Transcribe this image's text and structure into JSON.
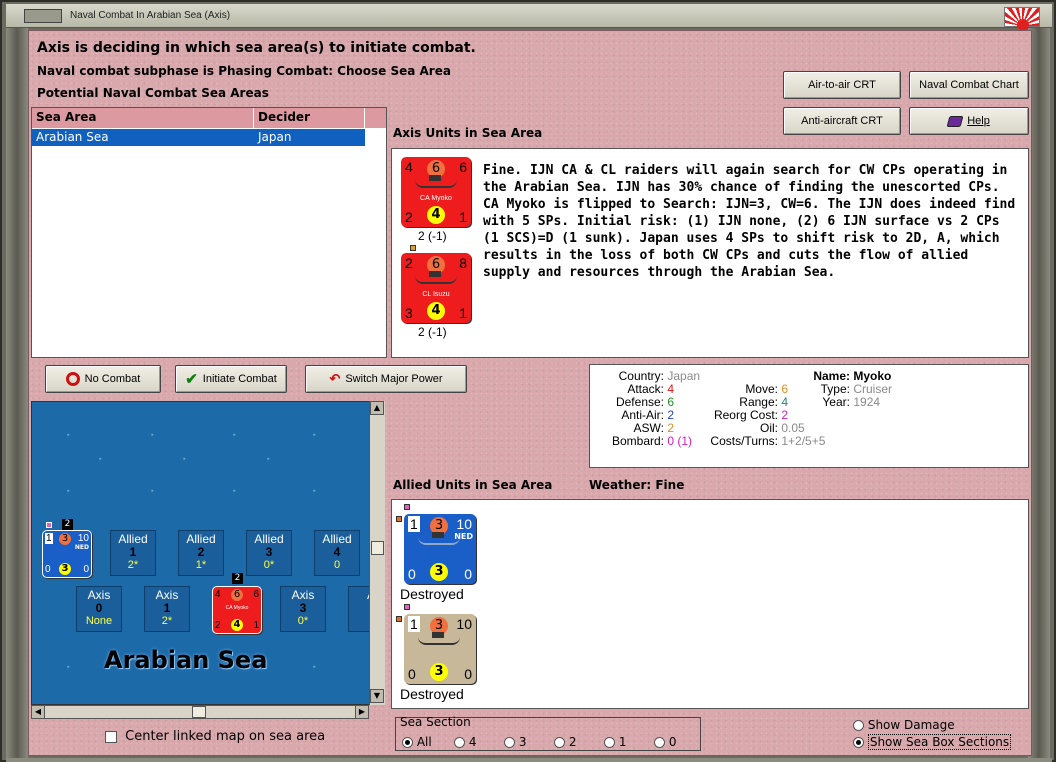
{
  "window": {
    "title": "Naval Combat In Arabian Sea (Axis)"
  },
  "headers": {
    "line1": "Axis is deciding in which sea area(s) to initiate combat.",
    "line2": "Naval combat subphase is Phasing Combat: Choose Sea Area",
    "line3": "Potential Naval Combat Sea Areas"
  },
  "buttons": {
    "air_to_air": "Air-to-air CRT",
    "naval_chart": "Naval Combat Chart",
    "anti_aircraft": "Anti-aircraft CRT",
    "help": "Help",
    "no_combat": "No Combat",
    "initiate_combat": "Initiate Combat",
    "switch_major_power": "Switch Major Power"
  },
  "sea_table": {
    "columns": [
      "Sea Area",
      "Decider"
    ],
    "rows": [
      [
        "Arabian Sea",
        "Japan"
      ]
    ]
  },
  "axis_units": {
    "heading": "Axis Units in Sea Area",
    "narrative": "Fine.  IJN CA & CL raiders will again search for CW CPs operating in the Arabian Sea.  IJN has 30% chance of finding the unescorted CPs.  CA Myoko is flipped to Search:  IJN=3, CW=6.  The IJN does indeed find with 5 SPs.  Initial risk:  (1) IJN none, (2) 6 IJN surface vs 2 CPs (1 SCS)=D (1 sunk).  Japan uses 4 SPs to shift risk to 2D, A, which results in the loss of both CW CPs and cuts the flow of allied supply and resources through the Arabian Sea.",
    "counters": [
      {
        "tl": "4",
        "tc": "6",
        "tr": "6",
        "name": "CA Myoko",
        "bl": "2",
        "bc": "4",
        "br": "1",
        "below": "2 (-1)"
      },
      {
        "tl": "2",
        "tc": "6",
        "tr": "8",
        "name": "CL Isuzu",
        "bl": "3",
        "bc": "4",
        "br": "1",
        "below": "2 (-1)"
      }
    ]
  },
  "details": {
    "country_label": "Country:",
    "country": "Japan",
    "attack_label": "Attack:",
    "attack": "4",
    "defense_label": "Defense:",
    "defense": "6",
    "antiair_label": "Anti-Air:",
    "antiair": "2",
    "asw_label": "ASW:",
    "asw": "2",
    "bombard_label": "Bombard:",
    "bombard": "0 (1)",
    "move_label": "Move:",
    "move": "6",
    "range_label": "Range:",
    "range": "4",
    "reorg_label": "Reorg Cost:",
    "reorg": "2",
    "oil_label": "Oil:",
    "oil": "0.05",
    "costs_label": "Costs/Turns:",
    "costs": "1+2/5+5",
    "name_label": "Name:",
    "name": "Myoko",
    "type_label": "Type:",
    "type": "Cruiser",
    "year_label": "Year:",
    "year": "1924"
  },
  "map": {
    "sea_name": "Arabian Sea",
    "allied_boxes": [
      {
        "label": "Allied",
        "num": "1",
        "val": "2*"
      },
      {
        "label": "Allied",
        "num": "2",
        "val": "1*"
      },
      {
        "label": "Allied",
        "num": "3",
        "val": "0*"
      },
      {
        "label": "Allied",
        "num": "4",
        "val": "0"
      }
    ],
    "axis_boxes": [
      {
        "label": "Axis",
        "num": "0",
        "val": "None"
      },
      {
        "label": "Axis",
        "num": "1",
        "val": "2*"
      },
      {
        "label": "Axis",
        "num": "3",
        "val": "0*"
      },
      {
        "label": "A",
        "num": "",
        "val": ""
      }
    ],
    "allied_stack_count": "2",
    "axis_stack_count": "2",
    "allied_counter": {
      "tl": "1",
      "tc": "3",
      "tr": "10",
      "tag": "NED",
      "bl": "0",
      "bc": "3",
      "br": "0"
    },
    "axis_counter": {
      "tl": "4",
      "tc": "6",
      "tr": "6",
      "name": "CA Myoko",
      "bl": "2",
      "bc": "4",
      "br": "1"
    }
  },
  "allied_units": {
    "heading": "Allied Units in Sea Area",
    "weather": "Weather:  Fine",
    "counters": [
      {
        "tl": "1",
        "tc": "3",
        "tr": "10",
        "tag": "NED",
        "bl": "0",
        "bc": "3",
        "br": "0",
        "status": "Destroyed"
      },
      {
        "tl": "1",
        "tc": "3",
        "tr": "10",
        "tag": "",
        "bl": "0",
        "bc": "3",
        "br": "0",
        "status": "Destroyed"
      }
    ]
  },
  "options": {
    "center_map": "Center linked map on sea area",
    "sea_section_label": "Sea Section",
    "sections": [
      "All",
      "4",
      "3",
      "2",
      "1",
      "0"
    ],
    "show_damage": "Show Damage",
    "show_sea_box": "Show Sea Box Sections"
  },
  "colors": {
    "accent_pink": "#dc9aa0",
    "selection_blue": "#1060c0",
    "sea_blue": "#1d6aa8"
  }
}
